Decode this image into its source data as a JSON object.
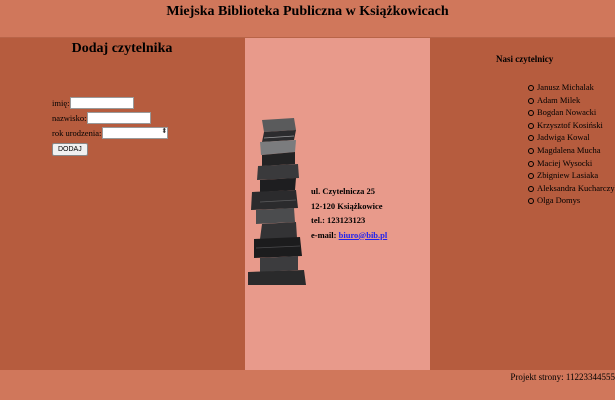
{
  "header": {
    "title": "Miejska Biblioteka Publiczna w Książkowicach"
  },
  "left": {
    "heading": "Dodaj czytelnika",
    "form": {
      "imie_label": "imię:",
      "nazwisko_label": "nazwisko:",
      "rok_label": "rok urodzenia:",
      "imie_value": "",
      "nazwisko_value": "",
      "rok_value": "",
      "button_label": "DODAJ"
    }
  },
  "middle": {
    "image_icon": "stack-of-books-image",
    "address_line1": "ul. Czytelnicza 25",
    "address_line2": "12-120 Książkowice",
    "phone": "tel.: 123123123",
    "email_label": "e-mail:",
    "email_link": "biuro@bib.pl"
  },
  "right": {
    "heading": "Nasi czytelnicy",
    "readers": [
      "Janusz Michalak",
      "Adam Milek",
      "Bogdan Nowacki",
      "Krzysztof Kosiński",
      "Jadwiga Kowal",
      "Magdalena Mucha",
      "Maciej Wysocki",
      "Zbigniew Lasiaka",
      "Aleksandra Kucharczyk",
      "Olga Domys"
    ]
  },
  "footer": {
    "text": "Projekt strony: 11223344555"
  },
  "colors": {
    "header_bg": "#d0775b",
    "side_bg": "#b65c3e",
    "middle_bg": "#e89a8b",
    "link": "#2222ee"
  }
}
